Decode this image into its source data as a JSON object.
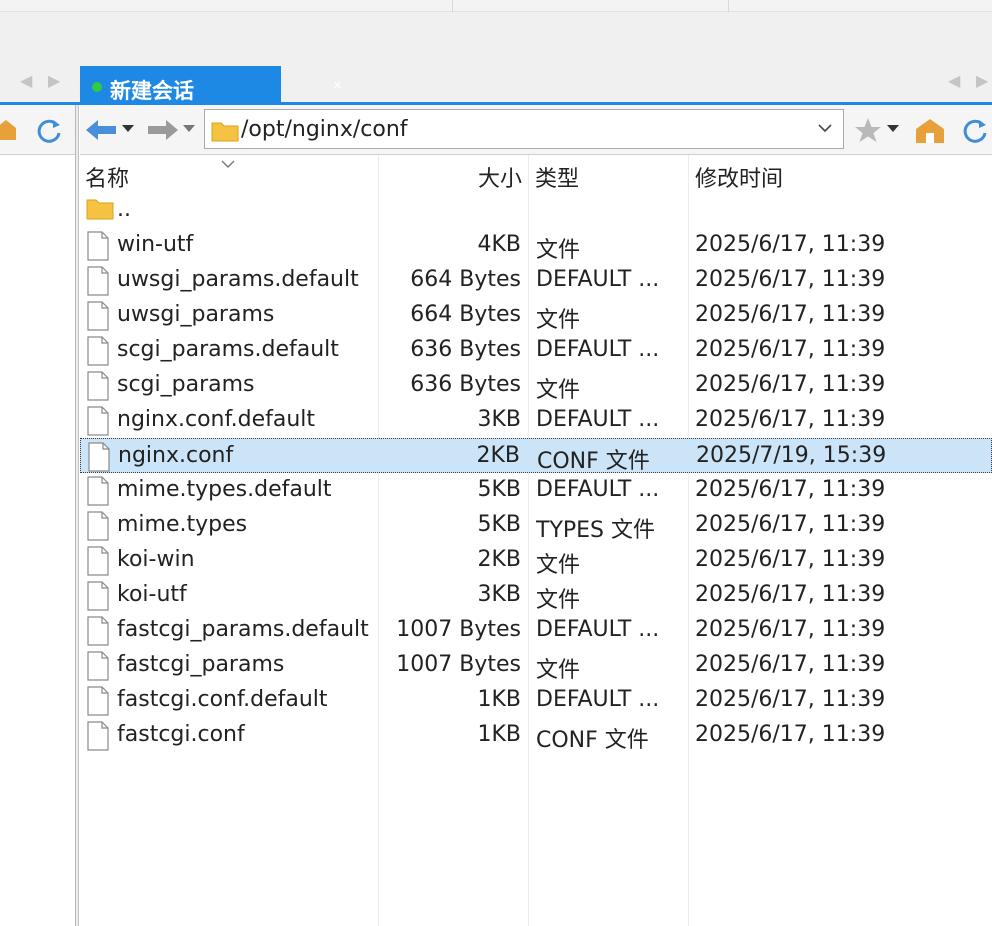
{
  "session_tab": {
    "title": "新建会话",
    "close": "×"
  },
  "path": {
    "value": "/opt/nginx/conf"
  },
  "columns": {
    "name": "名称",
    "size": "大小",
    "type": "类型",
    "modified": "修改时间"
  },
  "parent_dir": "..",
  "files": [
    {
      "name": "win-utf",
      "size": "4KB",
      "type": "文件",
      "modified": "2025/6/17, 11:39"
    },
    {
      "name": "uwsgi_params.default",
      "size": "664 Bytes",
      "type": "DEFAULT ...",
      "modified": "2025/6/17, 11:39"
    },
    {
      "name": "uwsgi_params",
      "size": "664 Bytes",
      "type": "文件",
      "modified": "2025/6/17, 11:39"
    },
    {
      "name": "scgi_params.default",
      "size": "636 Bytes",
      "type": "DEFAULT ...",
      "modified": "2025/6/17, 11:39"
    },
    {
      "name": "scgi_params",
      "size": "636 Bytes",
      "type": "文件",
      "modified": "2025/6/17, 11:39"
    },
    {
      "name": "nginx.conf.default",
      "size": "3KB",
      "type": "DEFAULT ...",
      "modified": "2025/6/17, 11:39"
    },
    {
      "name": "nginx.conf",
      "size": "2KB",
      "type": "CONF 文件",
      "modified": "2025/7/19, 15:39"
    },
    {
      "name": "mime.types.default",
      "size": "5KB",
      "type": "DEFAULT ...",
      "modified": "2025/6/17, 11:39"
    },
    {
      "name": "mime.types",
      "size": "5KB",
      "type": "TYPES 文件",
      "modified": "2025/6/17, 11:39"
    },
    {
      "name": "koi-win",
      "size": "2KB",
      "type": "文件",
      "modified": "2025/6/17, 11:39"
    },
    {
      "name": "koi-utf",
      "size": "3KB",
      "type": "文件",
      "modified": "2025/6/17, 11:39"
    },
    {
      "name": "fastcgi_params.default",
      "size": "1007 Bytes",
      "type": "DEFAULT ...",
      "modified": "2025/6/17, 11:39"
    },
    {
      "name": "fastcgi_params",
      "size": "1007 Bytes",
      "type": "文件",
      "modified": "2025/6/17, 11:39"
    },
    {
      "name": "fastcgi.conf.default",
      "size": "1KB",
      "type": "DEFAULT ...",
      "modified": "2025/6/17, 11:39"
    },
    {
      "name": "fastcgi.conf",
      "size": "1KB",
      "type": "CONF 文件",
      "modified": "2025/6/17, 11:39"
    }
  ],
  "selected_file": "nginx.conf",
  "colors": {
    "accent": "#1e88e5",
    "selection": "#cce4f7",
    "status_dot": "#2ecc40",
    "folder": "#f5c242",
    "home_icon": "#e8a13a"
  }
}
